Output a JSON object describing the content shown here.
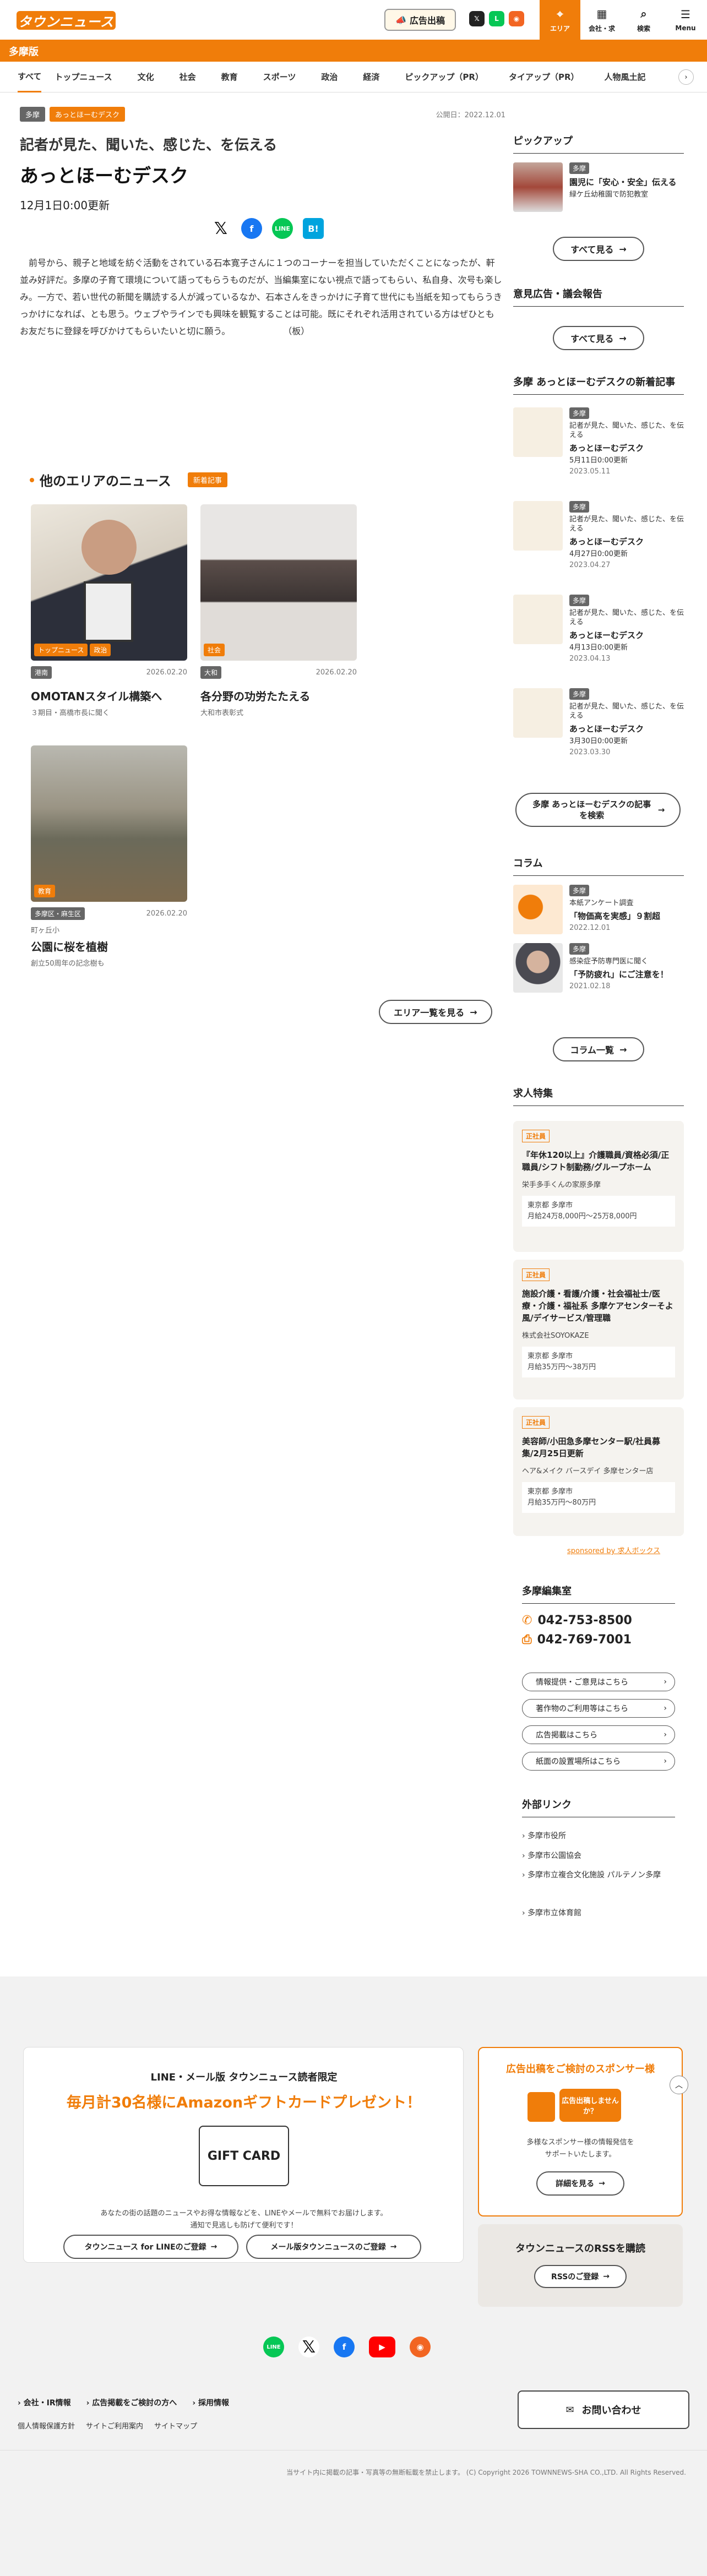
{
  "header": {
    "logo": "タウンニュース",
    "ad_button": "広告出稿",
    "nav": {
      "area": "エリア",
      "company": "会社・求",
      "search": "検索",
      "menu": "Menu"
    }
  },
  "edition": "多摩版",
  "tabs": [
    "すべて",
    "トップニュース",
    "文化",
    "社会",
    "教育",
    "スポーツ",
    "政治",
    "経済",
    "ピックアップ（PR）",
    "タイアップ（PR）",
    "人物風土記"
  ],
  "article": {
    "tag_area": "多摩",
    "tag_category": "あっとほーむデスク",
    "published": "公開日：2022.12.01",
    "subtitle": "記者が見た、聞いた、感じた、を伝える",
    "title": "あっとほーむデスク",
    "updated": "12月1日0:00更新",
    "body": "　前号から、親子と地域を紡ぐ活動をされている石本寛子さんに１つのコーナーを担当していただくことになったが、軒並み好評だ。多摩の子育て環境について語ってもらうものだが、当編集室にない視点で語ってもらい、私自身、次号も楽しみ。一方で、若い世代の新聞を購読する人が減っているなか、石本さんをきっかけに子育て世代にも当紙を知ってもらうきっかけになれば、とも思う。ウェブやラインでも興味を観覧することは可能。既にそれぞれ活用されている方はぜひともお友だちに登録を呼びかけてもらいたいと切に願う。　　　　　　　（板）"
  },
  "other_news": {
    "heading": "他のエリアのニュース",
    "new_label": "新着記事",
    "cards": [
      {
        "badges": [
          "トップニュース",
          "政治"
        ],
        "area": "港南",
        "date": "2026.02.20",
        "title": "OMOTANスタイル構築へ",
        "sub": "３期目・高橋市長に聞く"
      },
      {
        "badges": [
          "社会"
        ],
        "area": "大和",
        "date": "2026.02.20",
        "title": "各分野の功労たたえる",
        "sub": "大和市表彰式"
      },
      {
        "badges": [
          "教育"
        ],
        "area": "多摩区・麻生区",
        "date": "2026.02.20",
        "area2": "町ヶ丘小",
        "title": "公園に桜を植樹",
        "sub": "創立50周年の記念樹も"
      }
    ],
    "more_button": "エリア一覧を見る"
  },
  "sidebar": {
    "pickup": {
      "title": "ピックアップ",
      "tag": "多摩",
      "text": "園児に「安心・安全」伝える",
      "sub": "緑ケ丘幼稚園で防犯教室",
      "more": "すべて見る"
    },
    "opinion": {
      "title": "意見広告・議会報告",
      "more": "すべて見る"
    },
    "desk": {
      "title": "多摩 あっとほーむデスクの新着記事",
      "items": [
        {
          "tag": "多摩",
          "text": "記者が見た、聞いた、感じた、を伝える",
          "name": "あっとほーむデスク",
          "upd": "5月11日0:00更新",
          "date": "2023.05.11"
        },
        {
          "tag": "多摩",
          "text": "記者が見た、聞いた、感じた、を伝える",
          "name": "あっとほーむデスク",
          "upd": "4月27日0:00更新",
          "date": "2023.04.27"
        },
        {
          "tag": "多摩",
          "text": "記者が見た、聞いた、感じた、を伝える",
          "name": "あっとほーむデスク",
          "upd": "4月13日0:00更新",
          "date": "2023.04.13"
        },
        {
          "tag": "多摩",
          "text": "記者が見た、聞いた、感じた、を伝える",
          "name": "あっとほーむデスク",
          "upd": "3月30日0:00更新",
          "date": "2023.03.30"
        }
      ],
      "search_button": "多摩 あっとほーむデスクの記事を検索"
    },
    "column": {
      "title": "コラム",
      "items": [
        {
          "tag": "多摩",
          "text": "本紙アンケート調査",
          "bold": "「物価高を実感」９割超",
          "date": "2022.12.01"
        },
        {
          "tag": "多摩",
          "text": "感染症予防専門医に聞く",
          "bold": "「予防疲れ」にご注意を！",
          "date": "2021.02.18"
        }
      ],
      "more": "コラム一覧"
    },
    "jobs": {
      "title": "求人特集",
      "items": [
        {
          "tag": "正社員",
          "title": "『年休120以上』介護職員/資格必須/正職員/シフト制勤務/グループホーム",
          "company": "栄手多手くんの家原多摩",
          "loc": "東京都 多摩市",
          "pay": "月給24万8,000円〜25万8,000円"
        },
        {
          "tag": "正社員",
          "title": "施設介護・看護/介護・社会福祉士/医療・介護・福祉系 多摩ケアセンターそよ風/デイサービス/管理職",
          "company": "株式会社SOYOKAZE",
          "loc": "東京都 多摩市",
          "pay": "月給35万円〜38万円"
        },
        {
          "tag": "正社員",
          "title": "美容師/小田急多摩センター駅/社員募集/2月25日更新",
          "company": "ヘア&メイク バースデイ 多摩センター店",
          "loc": "東京都 多摩市",
          "pay": "月給35万円〜80万円"
        }
      ],
      "sponsored": "sponsored by 求人ボックス"
    },
    "office": {
      "title": "多摩編集室",
      "tel": "042-753-8500",
      "fax": "042-769-7001",
      "links": [
        "情報提供・ご意見はこちら",
        "著作物のご利用等はこちら",
        "広告掲載はこちら",
        "紙面の設置場所はこちら"
      ]
    },
    "external": {
      "title": "外部リンク",
      "links": [
        "多摩市役所",
        "多摩市公園協会",
        "多摩市立複合文化施設 パルテノン多摩",
        "多摩市立体育館"
      ]
    }
  },
  "footer": {
    "promo_small": "LINE・メール版 タウンニュース読者限定",
    "promo_big": "毎月計30名様にAmazonギフトカードプレゼント！",
    "gift_label": "GIFT CARD",
    "promo_desc1": "あなたの街の話題のニュースやお得な情報などを、LINEやメールで無料でお届けします。",
    "promo_desc2": "通知で見逃しも防げて便利です！",
    "btn_line": "タウンニュース for LINEのご登録",
    "btn_mail": "メール版タウンニュースのご登録",
    "sponsor_title": "広告出稿をご検討のスポンサー様",
    "sponsor_bubble": "広告出稿しませんか？",
    "sponsor_desc1": "多様なスポンサー様の情報発信を",
    "sponsor_desc2": "サポートいたします。",
    "sponsor_btn": "詳細を見る",
    "rss_title": "タウンニュースのRSSを購読",
    "rss_btn": "RSSのご登録",
    "links": [
      "会社・IR情報",
      "広告掲載をご検討の方へ",
      "採用情報"
    ],
    "links2": [
      "個人情報保護方針",
      "サイトご利用案内",
      "サイトマップ"
    ],
    "contact": "お問い合わせ",
    "copyright": "当サイト内に掲載の記事・写真等の無断転載を禁止します。 (C) Copyright 2026 TOWNNEWS-SHA CO.,LTD. All Rights Reserved."
  },
  "colors": {
    "accent": "#f07d0a",
    "line": "#06c755",
    "facebook": "#1877f2",
    "youtube": "#ff0000",
    "hatena": "#00a4de",
    "rss": "#f26522"
  }
}
